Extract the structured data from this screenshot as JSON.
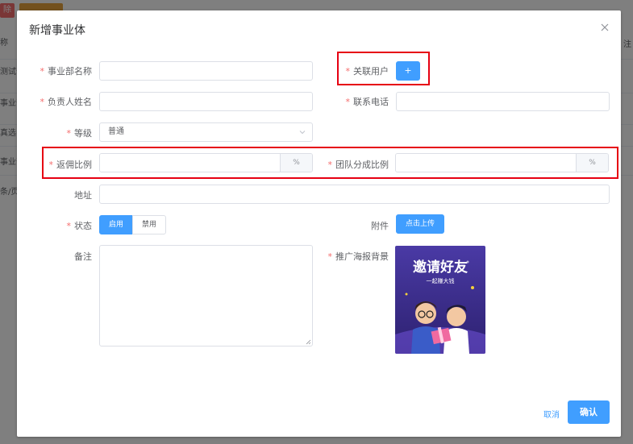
{
  "background": {
    "btn_red": "除",
    "rows": [
      "称",
      "测试部",
      "事业部",
      "真选",
      "事业部",
      "条/页"
    ],
    "right_text": "注"
  },
  "dialog": {
    "title": "新增事业体",
    "fields": {
      "dept_name": {
        "label": "事业部名称",
        "value": ""
      },
      "linked_user": {
        "label": "关联用户",
        "button": "+"
      },
      "manager_name": {
        "label": "负责人姓名",
        "value": ""
      },
      "phone": {
        "label": "联系电话",
        "value": ""
      },
      "level": {
        "label": "等级",
        "value": "普通"
      },
      "commission": {
        "label": "返佣比例",
        "value": "",
        "unit": "%"
      },
      "team_share": {
        "label": "团队分成比例",
        "value": "",
        "unit": "%"
      },
      "address": {
        "label": "地址",
        "value": ""
      },
      "status": {
        "label": "状态",
        "options": [
          "启用",
          "禁用"
        ],
        "selected": "启用"
      },
      "attachment": {
        "label": "附件",
        "button": "点击上传"
      },
      "remark": {
        "label": "备注",
        "value": ""
      },
      "poster_bg": {
        "label": "推广海报背景"
      }
    },
    "poster": {
      "title": "邀请好友",
      "subtitle": "一起赚大钱"
    },
    "footer": {
      "cancel": "取消",
      "confirm": "确认"
    }
  },
  "colors": {
    "primary": "#409eff",
    "required": "#f56c6c",
    "highlight": "#e60012",
    "poster_bg": "#3d2c8d"
  }
}
